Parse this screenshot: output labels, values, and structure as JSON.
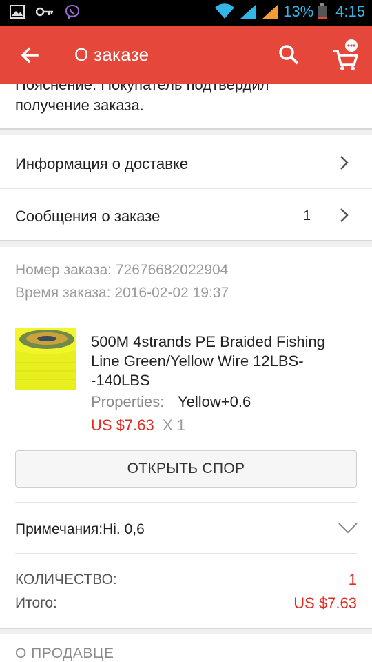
{
  "status_bar": {
    "battery_percent": "13%",
    "time": "4:15",
    "icons": [
      "image-icon",
      "key-icon",
      "viber-icon",
      "wifi-icon",
      "signal-icon",
      "signal-icon",
      "battery-icon"
    ]
  },
  "app_bar": {
    "title": "О заказе",
    "back_icon": "arrow-left-icon",
    "search_icon": "search-icon",
    "cart_icon": "cart-icon"
  },
  "note": {
    "cut_line": "Пояснение: Покупатель подтвердил",
    "text": "получение заказа."
  },
  "rows": {
    "delivery_label": "Информация о доставке",
    "messages_label": "Сообщения о заказе",
    "messages_count": "1"
  },
  "order": {
    "number_line": "Номер заказа: 72676682022904",
    "time_line": "Время заказа: 2016-02-02 19:37"
  },
  "product": {
    "title": "500M 4strands PE Braided Fishing Line Green/Yellow Wire 12LBS--140LBS",
    "properties_label": "Properties:",
    "properties_value": "Yellow+0.6",
    "price": "US $7.63",
    "quantity": "X 1"
  },
  "dispute_button": "ОТКРЫТЬ СПОР",
  "remarks": {
    "label": "Примечания:Hi. 0,6"
  },
  "summary": {
    "quantity_label": "КОЛИЧЕСТВО:",
    "quantity_value": "1",
    "total_label": "Итого:",
    "total_value": "US $7.63"
  },
  "seller_section": "О ПРОДАВЦЕ",
  "colors": {
    "accent": "#e5473b",
    "price": "#e5291c"
  }
}
